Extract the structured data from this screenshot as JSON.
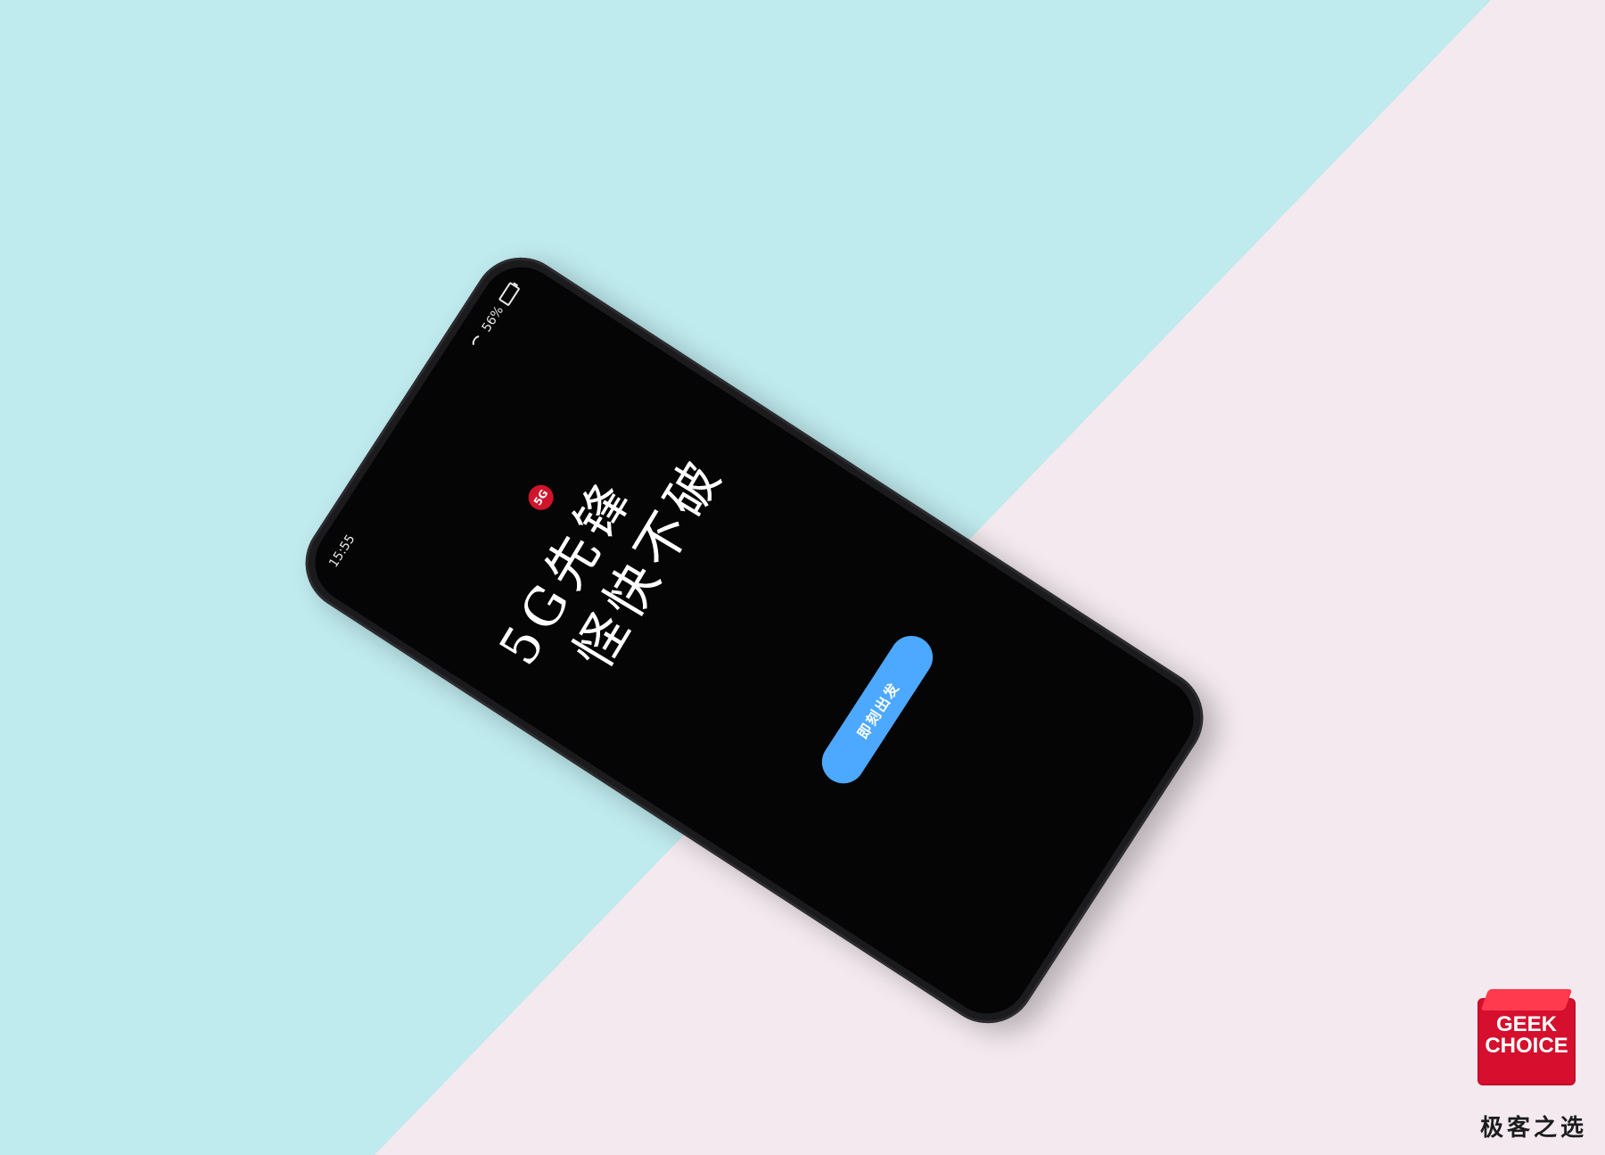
{
  "scene": {
    "background_colors": {
      "top_left": "#bfeaee",
      "bottom_right": "#f3e9ee"
    }
  },
  "phone": {
    "status_bar": {
      "time": "15:55",
      "right_text": "56%"
    },
    "badge": "5G",
    "headline": {
      "line1": "5G先锋",
      "line2": "怪快不破"
    },
    "cta_button": "即刻出发",
    "accent_color": "#4da8ff"
  },
  "watermark": {
    "brand_line1": "GEEK",
    "brand_line2": "CHOICE",
    "brand_cn": "极客之选",
    "brand_color": "#d50f2d"
  }
}
